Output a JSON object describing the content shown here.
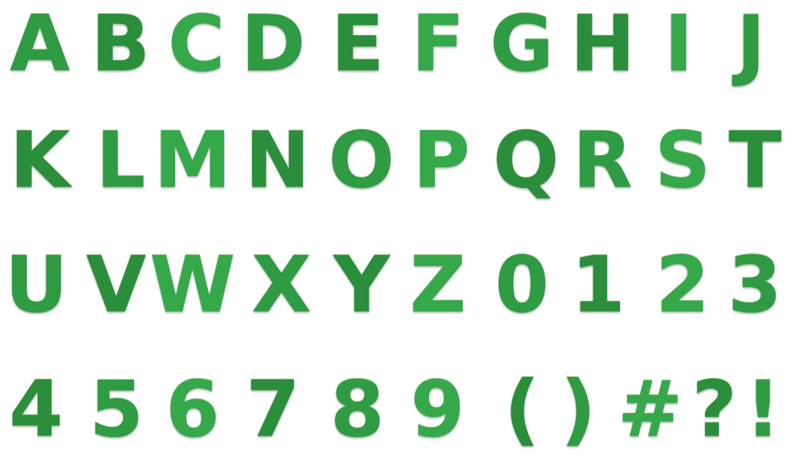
{
  "colors": {
    "background": "#ffffff",
    "glyph_primary": "#2f9b42",
    "glyph_alt_1": "#2a8e3b",
    "glyph_alt_2": "#35a84a"
  },
  "rows": [
    [
      "A",
      "B",
      "C",
      "D",
      "E",
      "F",
      "G",
      "H",
      "I",
      "J"
    ],
    [
      "K",
      "L",
      "M",
      "N",
      "O",
      "P",
      "Q",
      "R",
      "S",
      "T"
    ],
    [
      "U",
      "V",
      "W",
      "X",
      "Y",
      "Z",
      "0",
      "1",
      "2",
      "3"
    ],
    [
      "4",
      "5",
      "6",
      "7",
      "8",
      "9",
      "(",
      ")",
      "#",
      "?",
      "!"
    ]
  ]
}
